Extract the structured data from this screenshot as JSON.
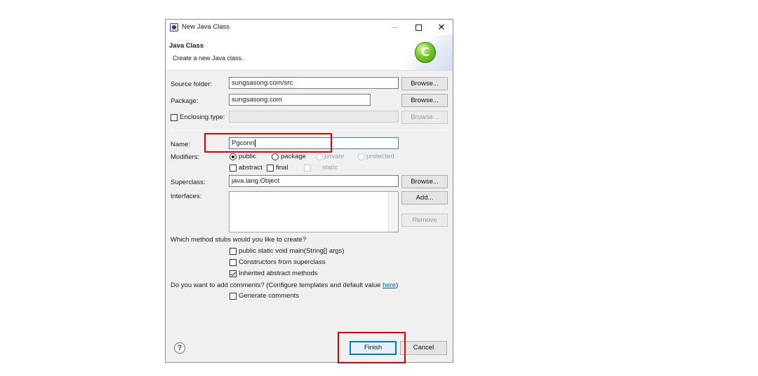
{
  "window": {
    "title": "New Java Class"
  },
  "header": {
    "title": "Java Class",
    "description": "Create a new Java class."
  },
  "source_folder": {
    "label": "Source folder:",
    "value": "sungsasong.com/src",
    "browse_label": "Browse..."
  },
  "package": {
    "label": "Package:",
    "value": "sungsasong.com",
    "browse_label": "Browse..."
  },
  "enclosing_type": {
    "label": "Enclosing type:",
    "value": "",
    "browse_label": "Browse...",
    "checked": false
  },
  "name": {
    "label": "Name:",
    "value": "Pgconn"
  },
  "modifiers": {
    "label": "Modifiers:",
    "access": [
      "public",
      "package",
      "private",
      "protected"
    ],
    "selected_access": "public",
    "abstract_label": "abstract",
    "final_label": "final",
    "static_label": "static"
  },
  "superclass": {
    "label": "Superclass:",
    "value": "java.lang.Object",
    "browse_label": "Browse..."
  },
  "interfaces": {
    "label": "Interfaces:",
    "add_label": "Add...",
    "remove_label": "Remove"
  },
  "method_stubs": {
    "question": "Which method stubs would you like to create?",
    "options": [
      {
        "label": "public static void main(String[] args)",
        "checked": false
      },
      {
        "label": "Constructors from superclass",
        "checked": false
      },
      {
        "label": "Inherited abstract methods",
        "checked": true
      }
    ]
  },
  "comments": {
    "question": "Do you want to add comments? (Configure templates and default value ",
    "link": "here",
    "question_end": ")",
    "option_label": "Generate comments",
    "checked": false
  },
  "footer": {
    "help_icon": "?",
    "finish_label": "Finish",
    "cancel_label": "Cancel"
  },
  "icons": {
    "app": "eclipse-app-icon",
    "wizard": "new-class-wizard-icon",
    "wizard_glyph": "C",
    "close_glyph": "✕"
  },
  "colors": {
    "highlight": "#e00000",
    "default_button_border": "#0078d7"
  }
}
